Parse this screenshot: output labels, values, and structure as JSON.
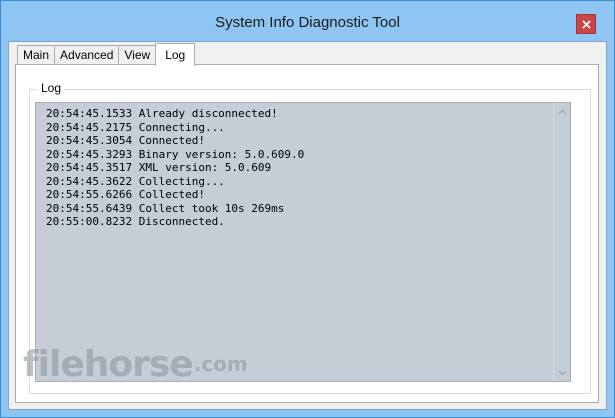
{
  "window": {
    "title": "System Info Diagnostic Tool"
  },
  "tabs": [
    {
      "label": "Main",
      "active": false
    },
    {
      "label": "Advanced",
      "active": false
    },
    {
      "label": "View",
      "active": false
    },
    {
      "label": "Log",
      "active": true
    }
  ],
  "log_group": {
    "label": "Log",
    "lines": [
      "20:54:45.1533 Already disconnected!",
      "20:54:45.2175 Connecting...",
      "20:54:45.3054 Connected!",
      "20:54:45.3293 Binary version: 5.0.609.0",
      "20:54:45.3517 XML version: 5.0.609",
      "20:54:45.3622 Collecting...",
      "20:54:55.6266 Collected!",
      "20:54:55.6439 Collect took 10s 269ms",
      "20:55:00.8232 Disconnected."
    ]
  },
  "watermark": {
    "brand": "filehorse",
    "tld": ".com"
  },
  "colors": {
    "titlebar": "#8ec5f2",
    "close_button": "#c94747",
    "log_background": "#c5ced6"
  },
  "icons": {
    "close": "close-icon",
    "scroll_up": "chevron-up-icon",
    "scroll_down": "chevron-down-icon"
  }
}
